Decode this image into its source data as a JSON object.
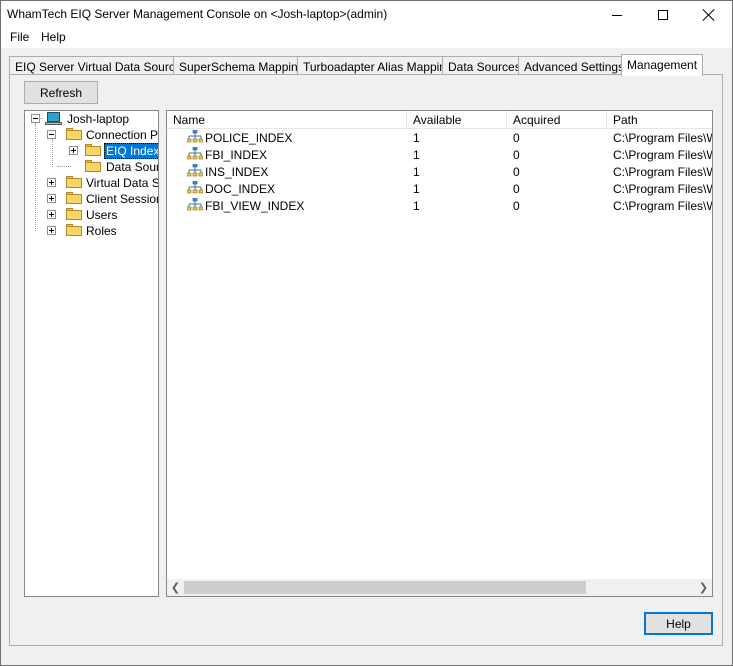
{
  "window": {
    "title": "WhamTech EIQ Server Management Console on <Josh-laptop>(admin)"
  },
  "menu": {
    "file": "File",
    "help": "Help"
  },
  "tabs": [
    {
      "label": "EIQ Server Virtual Data Sources"
    },
    {
      "label": "SuperSchema Mapping"
    },
    {
      "label": "Turboadapter Alias Mapping"
    },
    {
      "label": "Data Sources"
    },
    {
      "label": "Advanced Settings"
    },
    {
      "label": "Management"
    }
  ],
  "toolbar": {
    "refresh_label": "Refresh"
  },
  "tree": {
    "root": "Josh-laptop",
    "connection_pools": "Connection Po",
    "eiq_indexes": "EIQ Indexe",
    "data_sources": "Data Soun",
    "virtual_data_sources": "Virtual Data So",
    "client_sessions": "Client Sessions",
    "users": "Users",
    "roles": "Roles"
  },
  "list": {
    "columns": [
      "Name",
      "Available",
      "Acquired",
      "Path"
    ],
    "rows": [
      {
        "name": "POLICE_INDEX",
        "available": "1",
        "acquired": "0",
        "path": "C:\\Program Files\\Wh"
      },
      {
        "name": "FBI_INDEX",
        "available": "1",
        "acquired": "0",
        "path": "C:\\Program Files\\Wh"
      },
      {
        "name": "INS_INDEX",
        "available": "1",
        "acquired": "0",
        "path": "C:\\Program Files\\Wh"
      },
      {
        "name": "DOC_INDEX",
        "available": "1",
        "acquired": "0",
        "path": "C:\\Program Files\\Wh"
      },
      {
        "name": "FBI_VIEW_INDEX",
        "available": "1",
        "acquired": "0",
        "path": "C:\\Program Files\\Wh"
      }
    ]
  },
  "footer": {
    "help_label": "Help"
  },
  "colors": {
    "selection": "#0078d7",
    "window_bg": "#f0f0f0"
  }
}
